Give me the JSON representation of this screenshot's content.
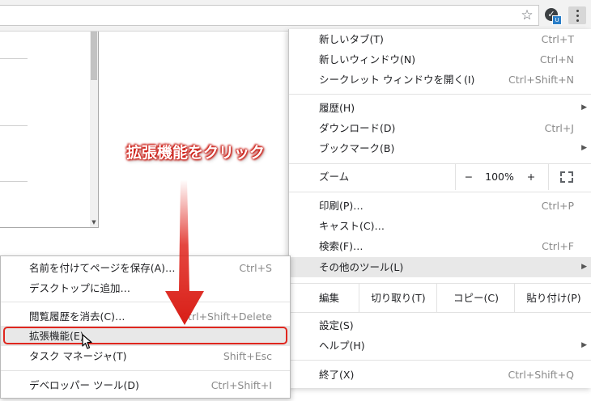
{
  "toolbar": {
    "star_glyph": "☆",
    "extension_glyph": "✓",
    "extension_badge": "U"
  },
  "menu": {
    "items": [
      {
        "label": "新しいタブ(T)",
        "shortcut": "Ctrl+T"
      },
      {
        "label": "新しいウィンドウ(N)",
        "shortcut": "Ctrl+N"
      },
      {
        "label": "シークレット ウィンドウを開く(I)",
        "shortcut": "Ctrl+Shift+N"
      },
      {
        "label": "履歴(H)",
        "shortcut": ""
      },
      {
        "label": "ダウンロード(D)",
        "shortcut": "Ctrl+J"
      },
      {
        "label": "ブックマーク(B)",
        "shortcut": ""
      },
      {
        "label": "印刷(P)…",
        "shortcut": "Ctrl+P"
      },
      {
        "label": "キャスト(C)…",
        "shortcut": ""
      },
      {
        "label": "検索(F)…",
        "shortcut": "Ctrl+F"
      },
      {
        "label": "その他のツール(L)",
        "shortcut": ""
      },
      {
        "label": "設定(S)",
        "shortcut": ""
      },
      {
        "label": "ヘルプ(H)",
        "shortcut": ""
      },
      {
        "label": "終了(X)",
        "shortcut": "Ctrl+Shift+Q"
      }
    ],
    "zoom": {
      "label": "ズーム",
      "minus": "−",
      "value": "100%",
      "plus": "+"
    },
    "edit": {
      "label": "編集",
      "cut": "切り取り(T)",
      "copy": "コピー(C)",
      "paste": "貼り付け(P)"
    },
    "submenu_arrow": "▶"
  },
  "submenu": {
    "items": [
      {
        "label": "名前を付けてページを保存(A)…",
        "shortcut": "Ctrl+S"
      },
      {
        "label": "デスクトップに追加…",
        "shortcut": ""
      },
      {
        "label": "閲覧履歴を消去(C)…",
        "shortcut": "Ctrl+Shift+Delete"
      },
      {
        "label": "拡張機能(E)",
        "shortcut": ""
      },
      {
        "label": "タスク マネージャ(T)",
        "shortcut": "Shift+Esc"
      },
      {
        "label": "デベロッパー ツール(D)",
        "shortcut": "Ctrl+Shift+I"
      }
    ]
  },
  "annotation": {
    "text": "拡張機能をクリック",
    "color": "#e0271f"
  },
  "colors": {
    "highlight": "#e8e8e8",
    "shortcut": "#8a8a8a",
    "accent_red": "#e0271f"
  }
}
